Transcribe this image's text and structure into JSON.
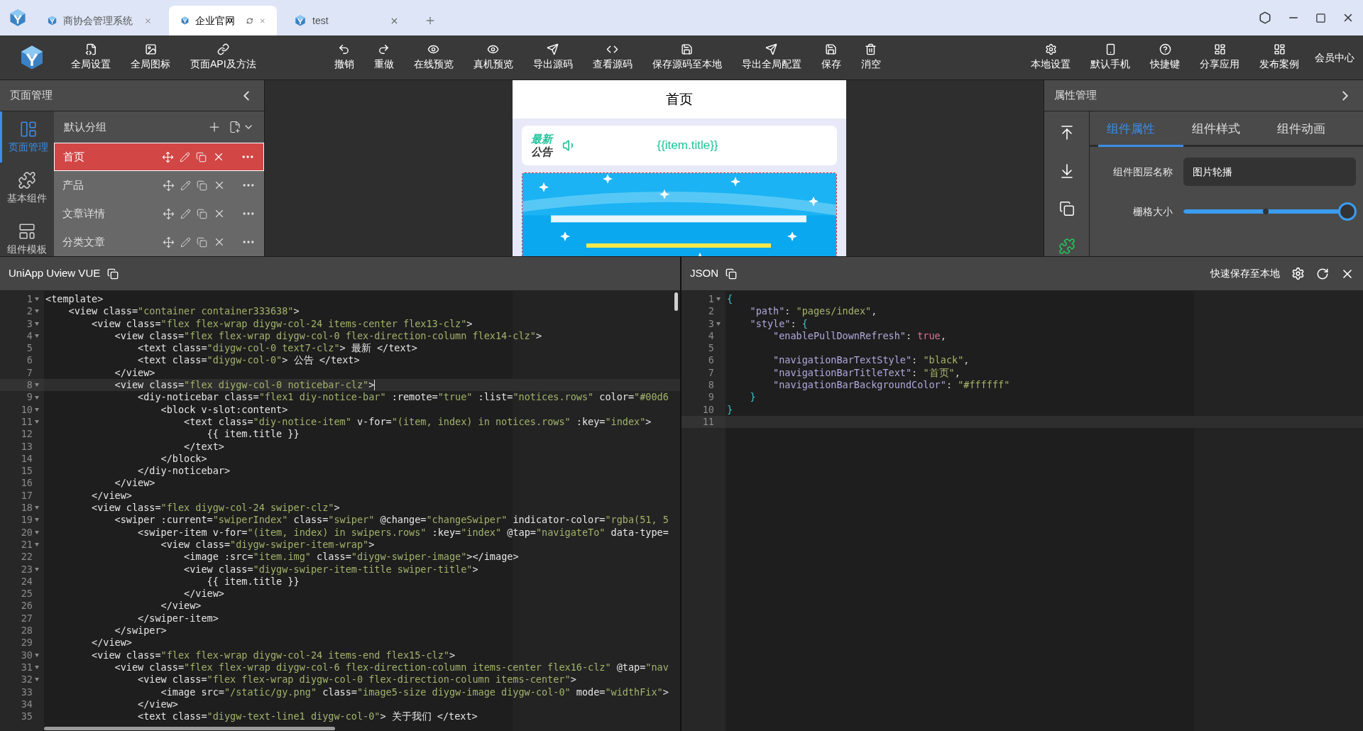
{
  "browser_tabs": [
    {
      "label": "商协会管理系统",
      "selected": false
    },
    {
      "label": "企业官网",
      "selected": true
    },
    {
      "label": "test",
      "selected": false
    }
  ],
  "toolbar": {
    "groups": [
      [
        "全局设置",
        "全局图标",
        "页面API及方法"
      ],
      [
        "撤销",
        "重做",
        "在线预览",
        "真机预览",
        "导出源码",
        "查看源码",
        "保存源码至本地",
        "导出全局配置",
        "保存",
        "消空"
      ],
      [
        "本地设置",
        "默认手机",
        "快捷键",
        "分享应用",
        "发布案例"
      ]
    ],
    "member_link": "会员中心"
  },
  "page_panel": {
    "title": "页面管理",
    "nav": [
      {
        "label": "页面管理",
        "selected": true
      },
      {
        "label": "基本组件",
        "selected": false
      },
      {
        "label": "组件模板",
        "selected": false
      }
    ],
    "group": "默认分组",
    "pages": [
      {
        "label": "首页",
        "selected": true
      },
      {
        "label": "产品",
        "selected": false
      },
      {
        "label": "文章详情",
        "selected": false
      },
      {
        "label": "分类文章",
        "selected": false
      }
    ]
  },
  "preview": {
    "title": "首页",
    "notice": {
      "line_1": "最新",
      "line_2": "公告",
      "text": "{{item.title}}"
    }
  },
  "property_panel": {
    "title": "属性管理",
    "tabs": [
      {
        "label": "组件属性",
        "selected": true
      },
      {
        "label": "组件样式",
        "selected": false
      },
      {
        "label": "组件动画",
        "selected": false
      }
    ],
    "fields": [
      {
        "kind": "text",
        "label": "组件图层名称",
        "value": "图片轮播"
      },
      {
        "kind": "slider",
        "label": "栅格大小",
        "level": 1
      }
    ]
  },
  "code_panes": [
    {
      "title": "UniApp Uview VUE",
      "kind": "markup",
      "lines": [
        {
          "n": "1",
          "text": "<template>",
          "fold": true,
          "current": false
        },
        {
          "n": "2",
          "text": "    <view class=\"container container333638\">",
          "fold": true,
          "current": false
        },
        {
          "n": "3",
          "text": "        <view class=\"flex flex-wrap diygw-col-24 items-center flex13-clz\">",
          "fold": true,
          "current": false
        },
        {
          "n": "4",
          "text": "            <view class=\"flex flex-wrap diygw-col-0 flex-direction-column flex14-clz\">",
          "fold": true,
          "current": false
        },
        {
          "n": "5",
          "text": "                <text class=\"diygw-col-0 text7-clz\"> 最新 </text>",
          "fold": false,
          "current": false
        },
        {
          "n": "6",
          "text": "                <text class=\"diygw-col-0\"> 公告 </text>",
          "fold": false,
          "current": false
        },
        {
          "n": "7",
          "text": "            </view>",
          "fold": false,
          "current": false
        },
        {
          "n": "8",
          "text": "            <view class=\"flex diygw-col-0 noticebar-clz\">",
          "fold": true,
          "current": true
        },
        {
          "n": "9",
          "text": "                <diy-noticebar class=\"flex1 diy-notice-bar\" :remote=\"true\" :list=\"notices.rows\" color=\"#00d6",
          "fold": true,
          "current": false
        },
        {
          "n": "10",
          "text": "                    <block v-slot:content>",
          "fold": true,
          "current": false
        },
        {
          "n": "11",
          "text": "                        <text class=\"diy-notice-item\" v-for=\"(item, index) in notices.rows\" :key=\"index\">",
          "fold": true,
          "current": false
        },
        {
          "n": "12",
          "text": "                            {{ item.title }}",
          "fold": false,
          "current": false
        },
        {
          "n": "13",
          "text": "                        </text>",
          "fold": false,
          "current": false
        },
        {
          "n": "14",
          "text": "                    </block>",
          "fold": false,
          "current": false
        },
        {
          "n": "15",
          "text": "                </diy-noticebar>",
          "fold": false,
          "current": false
        },
        {
          "n": "16",
          "text": "            </view>",
          "fold": false,
          "current": false
        },
        {
          "n": "17",
          "text": "        </view>",
          "fold": false,
          "current": false
        },
        {
          "n": "18",
          "text": "        <view class=\"flex diygw-col-24 swiper-clz\">",
          "fold": true,
          "current": false
        },
        {
          "n": "19",
          "text": "            <swiper :current=\"swiperIndex\" class=\"swiper\" @change=\"changeSwiper\" indicator-color=\"rgba(51, 5",
          "fold": true,
          "current": false
        },
        {
          "n": "20",
          "text": "                <swiper-item v-for=\"(item, index) in swipers.rows\" :key=\"index\" @tap=\"navigateTo\" data-type=",
          "fold": true,
          "current": false
        },
        {
          "n": "21",
          "text": "                    <view class=\"diygw-swiper-item-wrap\">",
          "fold": true,
          "current": false
        },
        {
          "n": "22",
          "text": "                        <image :src=\"item.img\" class=\"diygw-swiper-image\"></image>",
          "fold": false,
          "current": false
        },
        {
          "n": "23",
          "text": "                        <view class=\"diygw-swiper-item-title swiper-title\">",
          "fold": true,
          "current": false
        },
        {
          "n": "24",
          "text": "                            {{ item.title }}",
          "fold": false,
          "current": false
        },
        {
          "n": "25",
          "text": "                        </view>",
          "fold": false,
          "current": false
        },
        {
          "n": "26",
          "text": "                    </view>",
          "fold": false,
          "current": false
        },
        {
          "n": "27",
          "text": "                </swiper-item>",
          "fold": false,
          "current": false
        },
        {
          "n": "28",
          "text": "            </swiper>",
          "fold": false,
          "current": false
        },
        {
          "n": "29",
          "text": "        </view>",
          "fold": false,
          "current": false
        },
        {
          "n": "30",
          "text": "        <view class=\"flex flex-wrap diygw-col-24 items-end flex15-clz\">",
          "fold": true,
          "current": false
        },
        {
          "n": "31",
          "text": "            <view class=\"flex flex-wrap diygw-col-6 flex-direction-column items-center flex16-clz\" @tap=\"nav",
          "fold": true,
          "current": false
        },
        {
          "n": "32",
          "text": "                <view class=\"flex flex-wrap diygw-col-0 flex-direction-column items-center\">",
          "fold": true,
          "current": false
        },
        {
          "n": "33",
          "text": "                    <image src=\"/static/gy.png\" class=\"image5-size diygw-image diygw-col-0\" mode=\"widthFix\">",
          "fold": false,
          "current": false
        },
        {
          "n": "34",
          "text": "                </view>",
          "fold": false,
          "current": false
        },
        {
          "n": "35",
          "text": "                <text class=\"diygw-text-line1 diygw-col-0\"> 关于我们 </text>",
          "fold": false,
          "current": false
        }
      ]
    },
    {
      "title": "JSON",
      "kind": "json",
      "save_label": "快速保存至本地",
      "lines": [
        {
          "n": "1",
          "text": "{",
          "fold": true,
          "current": false
        },
        {
          "n": "2",
          "text": "    \"path\": \"pages/index\",",
          "fold": false,
          "current": false
        },
        {
          "n": "3",
          "text": "    \"style\": {",
          "fold": true,
          "current": false
        },
        {
          "n": "4",
          "text": "        \"enablePullDownRefresh\": true,",
          "fold": false,
          "current": false
        },
        {
          "n": "5",
          "fold": false,
          "current": false
        },
        {
          "n": "6",
          "text": "        \"navigationBarTextStyle\": \"black\",",
          "fold": false,
          "current": false
        },
        {
          "n": "7",
          "text": "        \"navigationBarTitleText\": \"首页\",",
          "fold": false,
          "current": false
        },
        {
          "n": "8",
          "text": "        \"navigationBarBackgroundColor\": \"#ffffff\"",
          "fold": false,
          "current": false
        },
        {
          "n": "9",
          "text": "    }",
          "fold": false,
          "current": false
        },
        {
          "n": "10",
          "text": "}",
          "fold": false,
          "current": false
        },
        {
          "n": "11",
          "fold": false,
          "current": true
        }
      ]
    }
  ]
}
